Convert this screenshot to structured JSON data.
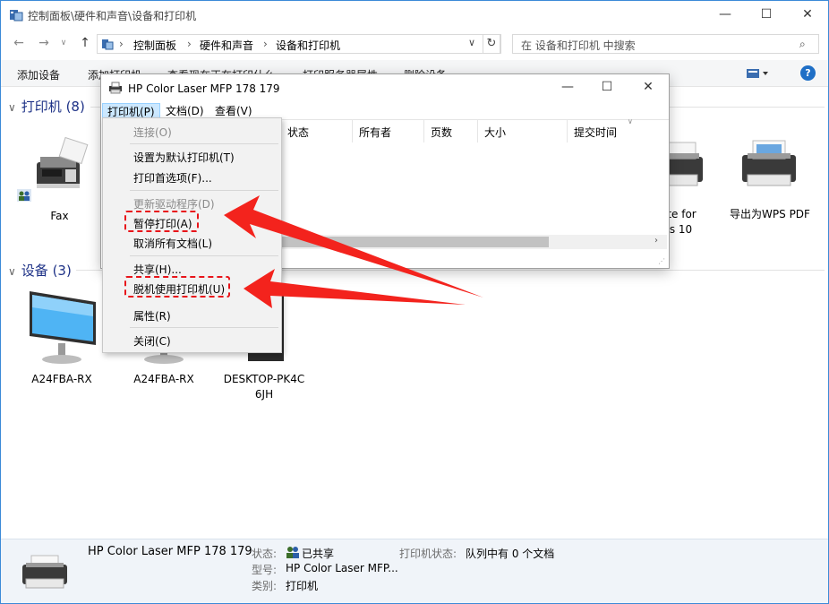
{
  "window": {
    "title": "控制面板\\硬件和声音\\设备和打印机",
    "buttons": {
      "minimize": "—",
      "maximize": "☐",
      "close": "✕"
    }
  },
  "address": {
    "crumbs": [
      "控制面板",
      "硬件和声音",
      "设备和打印机"
    ],
    "search_placeholder": "在 设备和打印机 中搜索"
  },
  "commandbar": {
    "items": [
      "添加设备",
      "添加打印机",
      "查看现在正在打印什么",
      "打印服务器属性",
      "删除设备"
    ]
  },
  "groups": {
    "printers": {
      "label": "打印机 (8)"
    },
    "devices": {
      "label": "设备 (3)"
    }
  },
  "printers": [
    {
      "name": "Fax"
    },
    {
      "name": "ote for"
    },
    {
      "name": "ws 10"
    },
    {
      "name": "导出为WPS PDF"
    }
  ],
  "devices": [
    {
      "name": "A24FBA-RX"
    },
    {
      "name": "A24FBA-RX"
    },
    {
      "name": "DESKTOP-PK4C"
    },
    {
      "name": "6JH"
    }
  ],
  "dialog": {
    "title": "HP Color Laser MFP 178 179",
    "menus": [
      "打印机(P)",
      "文档(D)",
      "查看(V)"
    ],
    "columns": [
      "状态",
      "所有者",
      "页数",
      "大小",
      "提交时间"
    ]
  },
  "dropdown": {
    "items": [
      {
        "label": "连接(O)",
        "disabled": true
      },
      {
        "label": "设置为默认打印机(T)",
        "disabled": false
      },
      {
        "label": "打印首选项(F)...",
        "disabled": false
      },
      {
        "label": "更新驱动程序(D)",
        "disabled": true
      },
      {
        "label": "暂停打印(A)",
        "disabled": false
      },
      {
        "label": "取消所有文档(L)",
        "disabled": false
      },
      {
        "label": "共享(H)...",
        "disabled": false
      },
      {
        "label": "脱机使用打印机(U)",
        "disabled": false
      },
      {
        "label": "属性(R)",
        "disabled": false
      },
      {
        "label": "关闭(C)",
        "disabled": false
      }
    ]
  },
  "statusbar": {
    "device_name": "HP Color Laser MFP 178 179",
    "status_label": "状态:",
    "status_value": "已共享",
    "model_label": "型号:",
    "model_value": "HP Color Laser MFP...",
    "category_label": "类别:",
    "category_value": "打印机",
    "printer_status_label": "打印机状态:",
    "printer_status_value": "队列中有 0 个文档"
  },
  "colors": {
    "accent": "#1e3287",
    "annotation": "#e8141a"
  }
}
